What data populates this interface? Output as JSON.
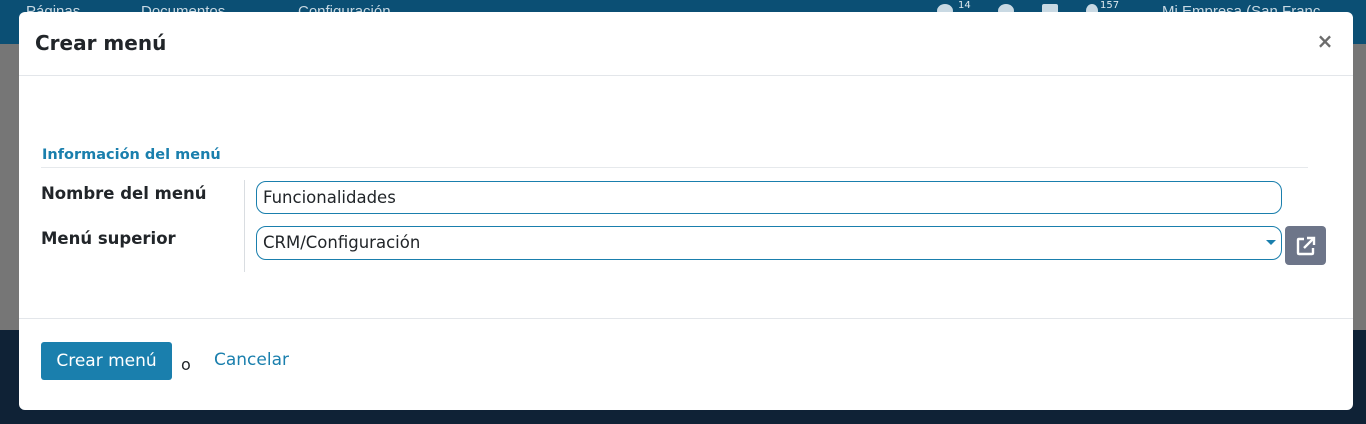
{
  "background": {
    "topbar": {
      "nav_items": [
        "Páginas",
        "Documentos",
        "Configuración"
      ],
      "notification_count": "14",
      "activity_count": "157",
      "company": "Mi Empresa (San Franc"
    }
  },
  "modal": {
    "title": "Crear menú",
    "close_symbol": "×",
    "section_title": "Información del menú",
    "fields": {
      "name_label": "Nombre del menú",
      "name_value": "Funcionalidades",
      "parent_label": "Menú superior",
      "parent_value": "CRM/Configuración"
    },
    "footer": {
      "create_label": "Crear menú",
      "or_text": "o",
      "cancel_label": "Cancelar"
    }
  },
  "colors": {
    "accent": "#1a7fad",
    "topbar": "#0b4f74",
    "secondary_button": "#6d7589"
  },
  "icons": {
    "close": "close-icon",
    "dropdown": "caret-down-icon",
    "external": "external-link-icon"
  }
}
